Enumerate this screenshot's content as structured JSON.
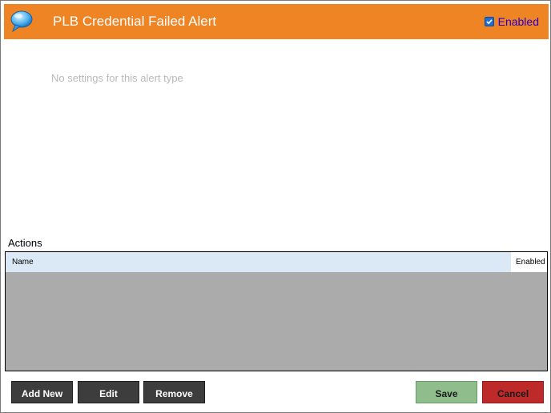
{
  "header": {
    "title": "PLB Credential Failed Alert",
    "icon": "chat-bubble-icon",
    "enabled_label": "Enabled",
    "enabled_checked": true
  },
  "settings": {
    "empty_message": "No settings for this alert type"
  },
  "actions": {
    "heading": "Actions",
    "columns": [
      "Name",
      "Enabled"
    ],
    "rows": []
  },
  "buttons": {
    "add_new": "Add New",
    "edit": "Edit",
    "remove": "Remove",
    "save": "Save",
    "cancel": "Cancel"
  },
  "colors": {
    "header_bg": "#ef8425",
    "grid_header_bg": "#dbe9f6",
    "grid_body_bg": "#ababab",
    "save_bg": "#8fbe8c",
    "cancel_bg": "#be2a2a",
    "dark_button_bg": "#3d3d3d"
  }
}
